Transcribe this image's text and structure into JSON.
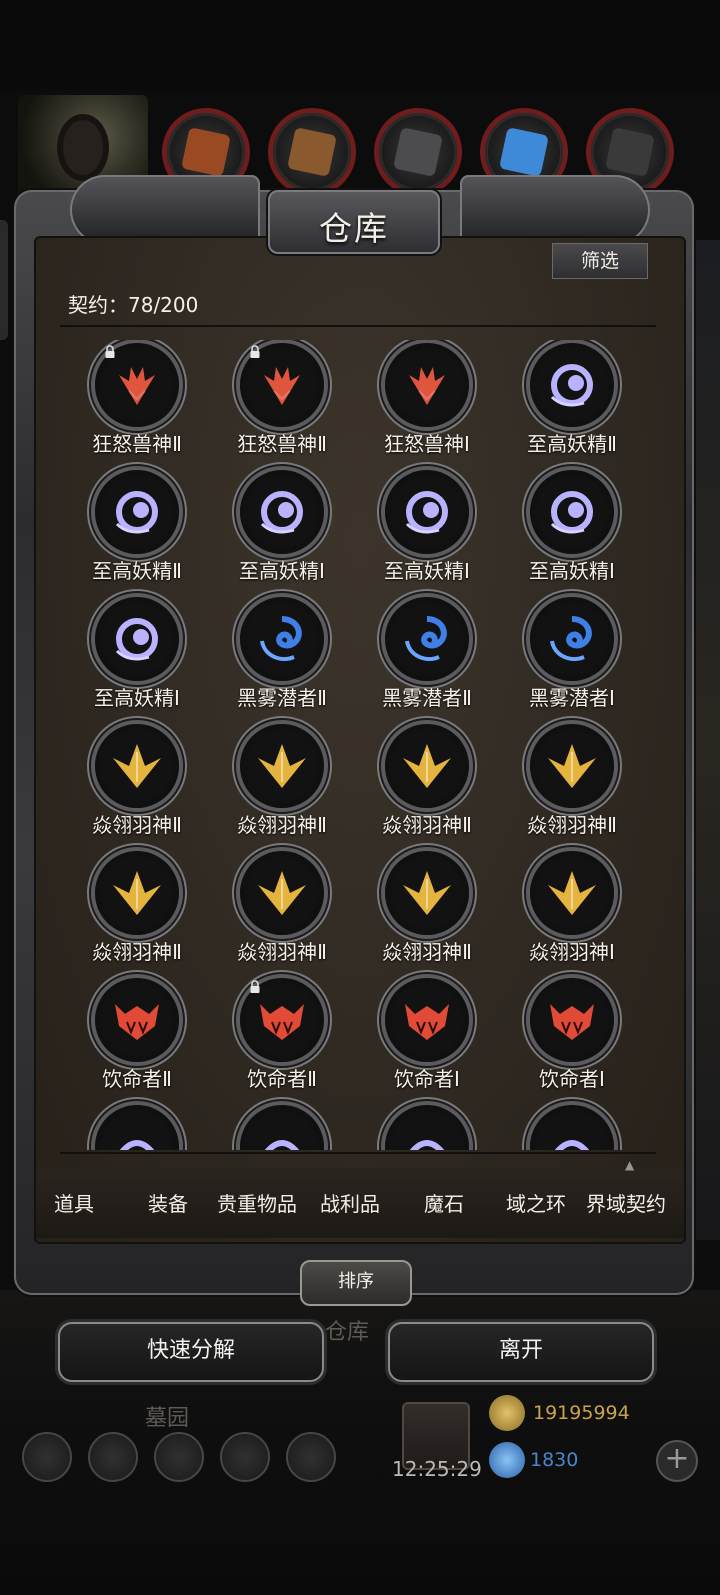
{
  "window": {
    "title": "仓库"
  },
  "header": {
    "filter_label": "筛选",
    "contract_label": "契约：78/200"
  },
  "colors": {
    "red": "#e0553e",
    "purple": "#b8b2ff",
    "blue": "#3f7fe6",
    "gold": "#e4b43e",
    "lifedrinker": "#e04a36"
  },
  "items": [
    {
      "name": "狂怒兽神Ⅱ",
      "icon": "red-beast-emblem-icon",
      "color": "red",
      "locked": true
    },
    {
      "name": "狂怒兽神Ⅱ",
      "icon": "red-beast-emblem-icon",
      "color": "red",
      "locked": true
    },
    {
      "name": "狂怒兽神Ⅰ",
      "icon": "red-beast-emblem-icon",
      "color": "red",
      "locked": false
    },
    {
      "name": "至高妖精Ⅱ",
      "icon": "purple-fairy-emblem-icon",
      "color": "purple",
      "locked": false
    },
    {
      "name": "至高妖精Ⅱ",
      "icon": "purple-fairy-emblem-icon",
      "color": "purple",
      "locked": false
    },
    {
      "name": "至高妖精Ⅰ",
      "icon": "purple-fairy-emblem-icon",
      "color": "purple",
      "locked": false
    },
    {
      "name": "至高妖精Ⅰ",
      "icon": "purple-fairy-emblem-icon",
      "color": "purple",
      "locked": false
    },
    {
      "name": "至高妖精Ⅰ",
      "icon": "purple-fairy-emblem-icon",
      "color": "purple",
      "locked": false
    },
    {
      "name": "至高妖精Ⅰ",
      "icon": "purple-fairy-emblem-icon",
      "color": "purple",
      "locked": false
    },
    {
      "name": "黑雾潜者Ⅱ",
      "icon": "blue-vortex-emblem-icon",
      "color": "blue",
      "locked": false
    },
    {
      "name": "黑雾潜者Ⅱ",
      "icon": "blue-vortex-emblem-icon",
      "color": "blue",
      "locked": false
    },
    {
      "name": "黑雾潜者Ⅰ",
      "icon": "blue-vortex-emblem-icon",
      "color": "blue",
      "locked": false
    },
    {
      "name": "焱翎羽神Ⅱ",
      "icon": "gold-wing-emblem-icon",
      "color": "gold",
      "locked": false
    },
    {
      "name": "焱翎羽神Ⅱ",
      "icon": "gold-wing-emblem-icon",
      "color": "gold",
      "locked": false
    },
    {
      "name": "焱翎羽神Ⅱ",
      "icon": "gold-wing-emblem-icon",
      "color": "gold",
      "locked": false
    },
    {
      "name": "焱翎羽神Ⅱ",
      "icon": "gold-wing-emblem-icon",
      "color": "gold",
      "locked": false
    },
    {
      "name": "焱翎羽神Ⅱ",
      "icon": "gold-wing-emblem-icon",
      "color": "gold",
      "locked": false
    },
    {
      "name": "焱翎羽神Ⅱ",
      "icon": "gold-wing-emblem-icon",
      "color": "gold",
      "locked": false
    },
    {
      "name": "焱翎羽神Ⅱ",
      "icon": "gold-wing-emblem-icon",
      "color": "gold",
      "locked": false
    },
    {
      "name": "焱翎羽神Ⅰ",
      "icon": "gold-wing-emblem-icon",
      "color": "gold",
      "locked": false
    },
    {
      "name": "饮命者Ⅱ",
      "icon": "red-fang-emblem-icon",
      "color": "lifedrinker",
      "locked": false
    },
    {
      "name": "饮命者Ⅱ",
      "icon": "red-fang-emblem-icon",
      "color": "lifedrinker",
      "locked": true
    },
    {
      "name": "饮命者Ⅰ",
      "icon": "red-fang-emblem-icon",
      "color": "lifedrinker",
      "locked": false
    },
    {
      "name": "饮命者Ⅰ",
      "icon": "red-fang-emblem-icon",
      "color": "lifedrinker",
      "locked": false
    },
    {
      "name": "",
      "icon": "purple-emblem-icon",
      "color": "purple",
      "locked": false
    },
    {
      "name": "",
      "icon": "purple-emblem-icon",
      "color": "purple",
      "locked": false
    },
    {
      "name": "",
      "icon": "purple-emblem-icon",
      "color": "purple",
      "locked": false
    },
    {
      "name": "",
      "icon": "purple-emblem-icon",
      "color": "purple",
      "locked": false
    }
  ],
  "tabs": [
    "道具",
    "装备",
    "贵重物品",
    "战利品",
    "魔石",
    "域之环",
    "界域契约"
  ],
  "sort_label": "排序",
  "actions": {
    "quick_decompose": "快速分解",
    "leave": "离开"
  },
  "background": {
    "warehouse_label": "仓库",
    "graveyard_label": "墓园",
    "clock": "12:25:29",
    "gold": "19195994",
    "gems": "1830",
    "plus": "+"
  }
}
